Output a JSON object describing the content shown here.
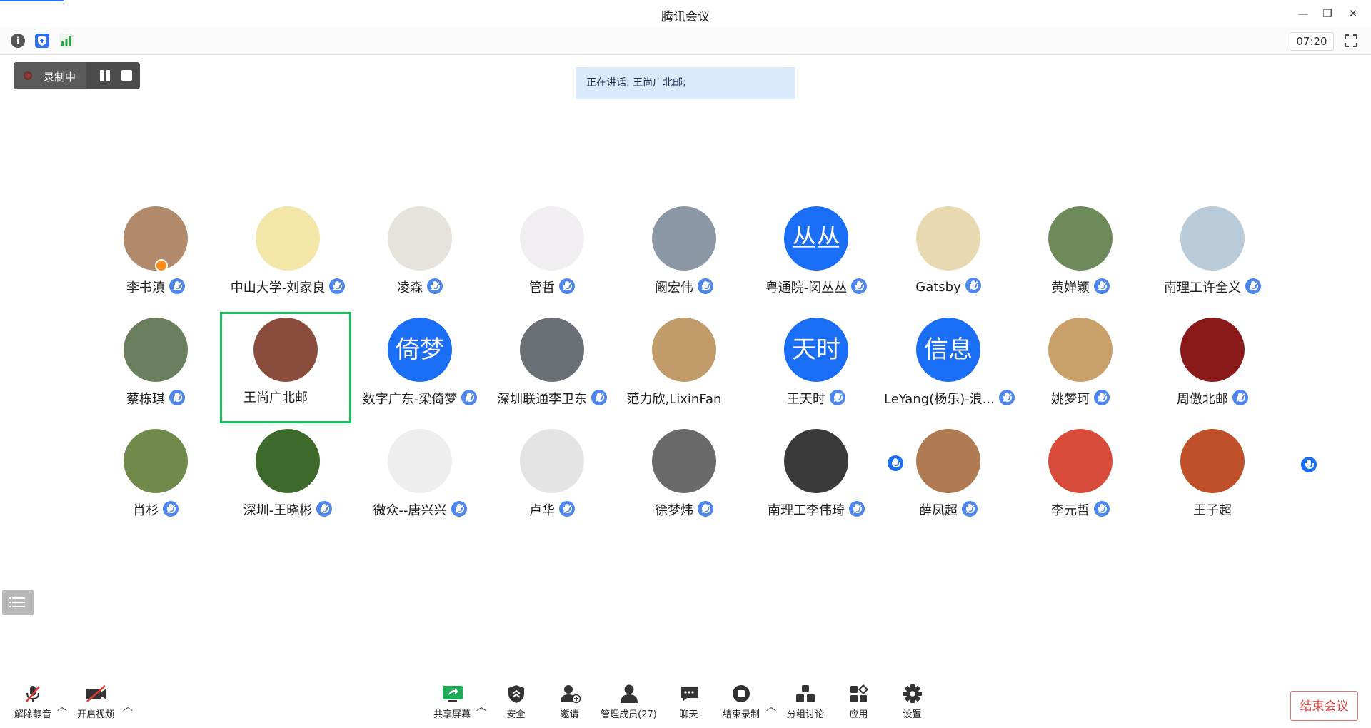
{
  "window": {
    "title": "腾讯会议"
  },
  "infobar": {
    "timer": "07:20"
  },
  "recording": {
    "label": "录制中"
  },
  "speaking": {
    "text": "正在讲话: 王尚广北邮;"
  },
  "participants": [
    {
      "name": "李书滇",
      "mic": "on",
      "avatar_color": "#b08a6a",
      "host": true
    },
    {
      "name": "中山大学-刘家良",
      "mic": "on",
      "avatar_color": "#f2e6a8"
    },
    {
      "name": "凌森",
      "mic": "on",
      "avatar_color": "#e6e2dc"
    },
    {
      "name": "管哲",
      "mic": "on",
      "avatar_color": "#f1eef2"
    },
    {
      "name": "阚宏伟",
      "mic": "on",
      "avatar_color": "#8c97a6"
    },
    {
      "name": "粤通院-闵丛丛",
      "mic": "on",
      "avatar_color": "#1a6ef5",
      "avatar_text": "丛丛"
    },
    {
      "name": "Gatsby",
      "mic": "on",
      "avatar_color": "#e8d9b0"
    },
    {
      "name": "黄婵颖",
      "mic": "on",
      "avatar_color": "#6f8a5a"
    },
    {
      "name": "南理工许全义",
      "mic": "on",
      "avatar_color": "#b9cbd9"
    },
    {
      "name": "蔡栋琪",
      "mic": "on",
      "avatar_color": "#6a7f5d"
    },
    {
      "name": "王尚广北邮",
      "mic": "speaking",
      "avatar_color": "#8a4c3c",
      "active": true
    },
    {
      "name": "数字广东-梁倚梦",
      "mic": "on",
      "avatar_color": "#1a6ef5",
      "avatar_text": "倚梦"
    },
    {
      "name": "深圳联通李卫东",
      "mic": "on",
      "avatar_color": "#6a6f76"
    },
    {
      "name": "范力欣,LixinFan",
      "mic": "speaking",
      "avatar_color": "#c29b6a"
    },
    {
      "name": "王天时",
      "mic": "on",
      "avatar_color": "#1a6ef5",
      "avatar_text": "天时"
    },
    {
      "name": "LeYang(杨乐)-浪...",
      "mic": "on",
      "avatar_color": "#1a6ef5",
      "avatar_text": "信息"
    },
    {
      "name": "姚梦珂",
      "mic": "on",
      "avatar_color": "#c9a06a"
    },
    {
      "name": "周傲北邮",
      "mic": "on",
      "avatar_color": "#8a1a1a"
    },
    {
      "name": "肖杉",
      "mic": "on",
      "avatar_color": "#6f8a4a"
    },
    {
      "name": "深圳-王晓彬",
      "mic": "on",
      "avatar_color": "#3d6a2a"
    },
    {
      "name": "微众--唐兴兴",
      "mic": "on",
      "avatar_color": "#eeeeee"
    },
    {
      "name": "卢华",
      "mic": "on",
      "avatar_color": "#e4e4e4"
    },
    {
      "name": "徐梦炜",
      "mic": "on",
      "avatar_color": "#6a6a6a"
    },
    {
      "name": "南理工李伟琦",
      "mic": "on",
      "avatar_color": "#3a3a3a"
    },
    {
      "name": "薛凤超",
      "mic": "on",
      "avatar_color": "#b07a52"
    },
    {
      "name": "李元哲",
      "mic": "on",
      "avatar_color": "#d84a3a"
    },
    {
      "name": "王子超",
      "mic": "none",
      "avatar_color": "#c0502a"
    }
  ],
  "toolbar": {
    "unmute": "解除静音",
    "start_video": "开启视频",
    "share_screen": "共享屏幕",
    "security": "安全",
    "invite": "邀请",
    "manage_members": "管理成员(27)",
    "chat": "聊天",
    "end_recording": "结束录制",
    "breakout": "分组讨论",
    "apps": "应用",
    "settings": "设置",
    "end_meeting": "结束会议"
  }
}
